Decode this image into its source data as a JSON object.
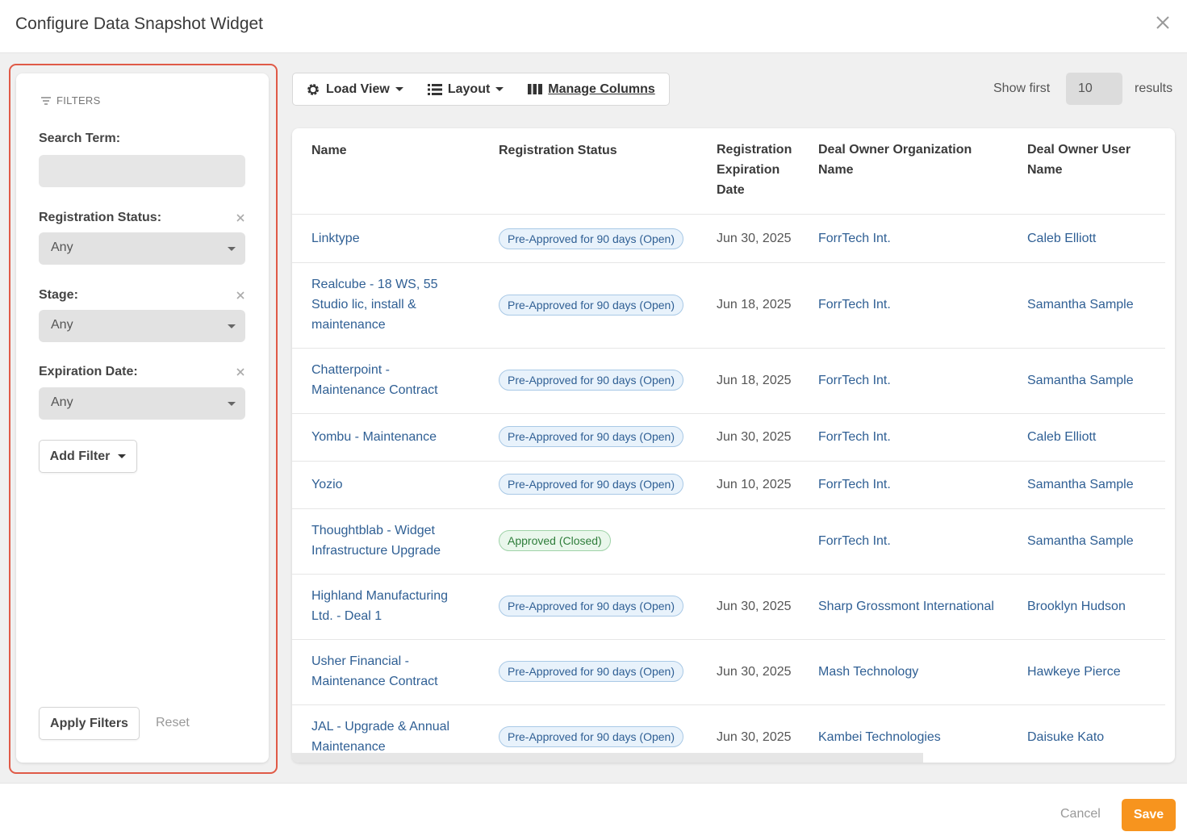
{
  "modal": {
    "title": "Configure Data Snapshot Widget"
  },
  "filters": {
    "heading": "FILTERS",
    "search_label": "Search Term:",
    "search_value": "",
    "registration_status_label": "Registration Status:",
    "registration_status_value": "Any",
    "stage_label": "Stage:",
    "stage_value": "Any",
    "expiration_label": "Expiration Date:",
    "expiration_value": "Any",
    "add_filter": "Add Filter",
    "apply": "Apply Filters",
    "reset": "Reset"
  },
  "toolbar": {
    "load_view": "Load View",
    "layout": "Layout",
    "manage_columns": "Manage Columns",
    "show_first": "Show first",
    "results_count": "10",
    "results": "results"
  },
  "table": {
    "headers": {
      "name": "Name",
      "status": "Registration Status",
      "exp1": "Registration",
      "exp2": "Expiration",
      "exp3": "Date",
      "org1": "Deal Owner Organization",
      "org2": "Name",
      "user1": "Deal Owner User",
      "user2": "Name"
    },
    "rows": [
      {
        "name1": "Linktype",
        "name2": "",
        "name3": "",
        "status": "Pre-Approved for 90 days (Open)",
        "date": "Jun 30, 2025",
        "org": "ForrTech Int.",
        "user": "Caleb Elliott"
      },
      {
        "name1": "Realcube - 18 WS, 55",
        "name2": "Studio lic, install &",
        "name3": "maintenance",
        "status": "Pre-Approved for 90 days (Open)",
        "date": "Jun 18, 2025",
        "org": "ForrTech Int.",
        "user": "Samantha Sample"
      },
      {
        "name1": "Chatterpoint -",
        "name2": "Maintenance Contract",
        "name3": "",
        "status": "Pre-Approved for 90 days (Open)",
        "date": "Jun 18, 2025",
        "org": "ForrTech Int.",
        "user": "Samantha Sample"
      },
      {
        "name1": "Yombu - Maintenance",
        "name2": "",
        "name3": "",
        "status": "Pre-Approved for 90 days (Open)",
        "date": "Jun 30, 2025",
        "org": "ForrTech Int.",
        "user": "Caleb Elliott"
      },
      {
        "name1": "Yozio",
        "name2": "",
        "name3": "",
        "status": "Pre-Approved for 90 days (Open)",
        "date": "Jun 10, 2025",
        "org": "ForrTech Int.",
        "user": "Samantha Sample"
      },
      {
        "name1": "Thoughtblab - Widget",
        "name2": "Infrastructure Upgrade",
        "name3": "",
        "status": "Approved (Closed)",
        "date": "",
        "org": "ForrTech Int.",
        "user": "Samantha Sample"
      },
      {
        "name1": "Highland Manufacturing",
        "name2": "Ltd. - Deal 1",
        "name3": "",
        "status": "Pre-Approved for 90 days (Open)",
        "date": "Jun 30, 2025",
        "org": "Sharp Grossmont International",
        "user": "Brooklyn Hudson"
      },
      {
        "name1": "Usher Financial -",
        "name2": "Maintenance Contract",
        "name3": "",
        "status": "Pre-Approved for 90 days (Open)",
        "date": "Jun 30, 2025",
        "org": "Mash Technology",
        "user": "Hawkeye Pierce"
      },
      {
        "name1": "JAL - Upgrade & Annual",
        "name2": "Maintenance",
        "name3": "",
        "status": "Pre-Approved for 90 days (Open)",
        "date": "Jun 30, 2025",
        "org": "Kambei Technologies",
        "user": "Daisuke Kato"
      }
    ]
  },
  "footer": {
    "cancel": "Cancel",
    "save": "Save"
  },
  "colors": {
    "accent": "#f7941e",
    "highlight": "#e05a47",
    "link": "#2f5f94"
  }
}
